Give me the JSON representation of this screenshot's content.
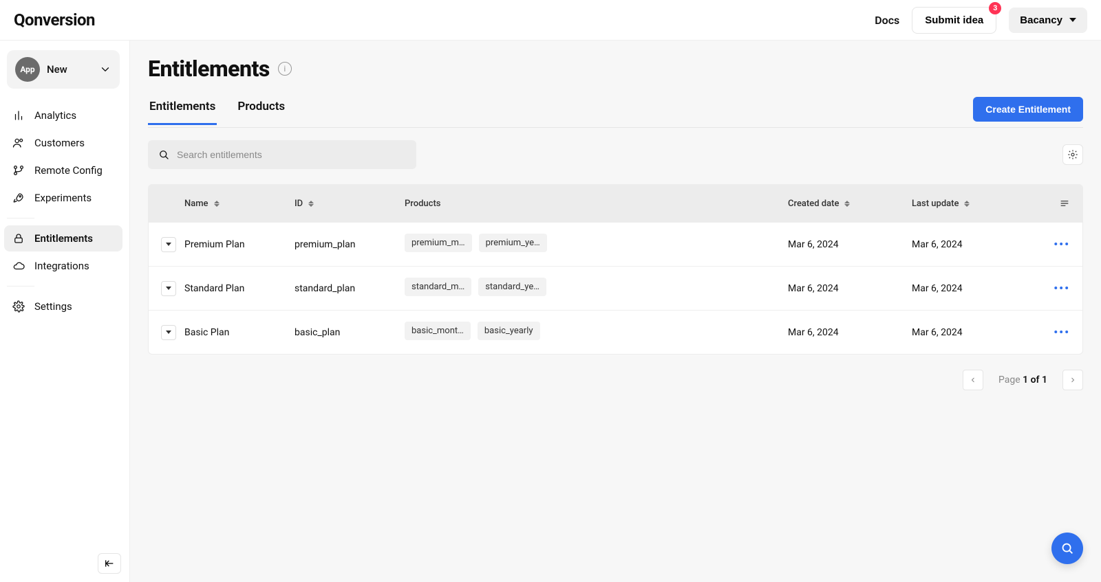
{
  "brand": "Qonversion",
  "header": {
    "docs": "Docs",
    "submit_idea": "Submit idea",
    "submit_idea_badge": "3",
    "account": "Bacancy"
  },
  "app_picker": {
    "badge": "App",
    "name": "New"
  },
  "sidebar": {
    "items": [
      {
        "label": "Analytics",
        "icon": "bar-chart"
      },
      {
        "label": "Customers",
        "icon": "users"
      },
      {
        "label": "Remote Config",
        "icon": "branch"
      },
      {
        "label": "Experiments",
        "icon": "rocket"
      }
    ],
    "items2": [
      {
        "label": "Entitlements",
        "icon": "lock",
        "active": true
      },
      {
        "label": "Integrations",
        "icon": "cloud"
      }
    ],
    "items3": [
      {
        "label": "Settings",
        "icon": "gear"
      }
    ]
  },
  "page": {
    "title": "Entitlements",
    "tabs": [
      "Entitlements",
      "Products"
    ],
    "active_tab_index": 0,
    "create_button": "Create Entitlement",
    "search_placeholder": "Search entitlements"
  },
  "table": {
    "columns": {
      "name": "Name",
      "id": "ID",
      "products": "Products",
      "created": "Created date",
      "updated": "Last update"
    },
    "rows": [
      {
        "name": "Premium Plan",
        "id": "premium_plan",
        "products": [
          "premium_m…",
          "premium_ye…"
        ],
        "created": "Mar 6, 2024",
        "updated": "Mar 6, 2024"
      },
      {
        "name": "Standard Plan",
        "id": "standard_plan",
        "products": [
          "standard_m…",
          "standard_ye…"
        ],
        "created": "Mar 6, 2024",
        "updated": "Mar 6, 2024"
      },
      {
        "name": "Basic Plan",
        "id": "basic_plan",
        "products": [
          "basic_mont…",
          "basic_yearly"
        ],
        "created": "Mar 6, 2024",
        "updated": "Mar 6, 2024"
      }
    ]
  },
  "pagination": {
    "prefix": "Page ",
    "range": "1 of 1"
  }
}
